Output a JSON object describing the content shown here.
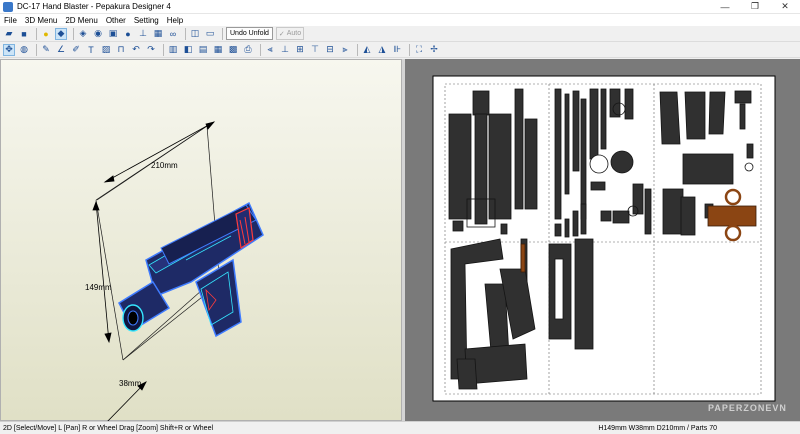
{
  "window": {
    "title": "DC-17 Hand Blaster - Pepakura Designer 4",
    "minimize": "—",
    "restore": "❐",
    "close": "✕"
  },
  "menu": [
    "File",
    "3D Menu",
    "2D Menu",
    "Other",
    "Setting",
    "Help"
  ],
  "toolbar": {
    "undo_unfold": "Undo Unfold",
    "auto_label": "Auto"
  },
  "view3d": {
    "dimensions": {
      "width": "210mm",
      "height": "149mm",
      "depth": "38mm"
    },
    "colors": {
      "body": "#1e2a66",
      "edge_blue": "#3f7cff",
      "edge_cyan": "#35e6ff",
      "accent_red": "#ff3b3b"
    }
  },
  "view2d": {
    "colors": {
      "part": "#303030",
      "part_edge": "#141414",
      "brown": "#8b4513",
      "page": "#ffffff"
    }
  },
  "status": {
    "left": "2D [Select/Move] L [Pan] R or Wheel Drag [Zoom] Shift+R or Wheel",
    "right": "H149mm W38mm D210mm / Parts 70"
  },
  "watermark": "PAPERZONEVN"
}
